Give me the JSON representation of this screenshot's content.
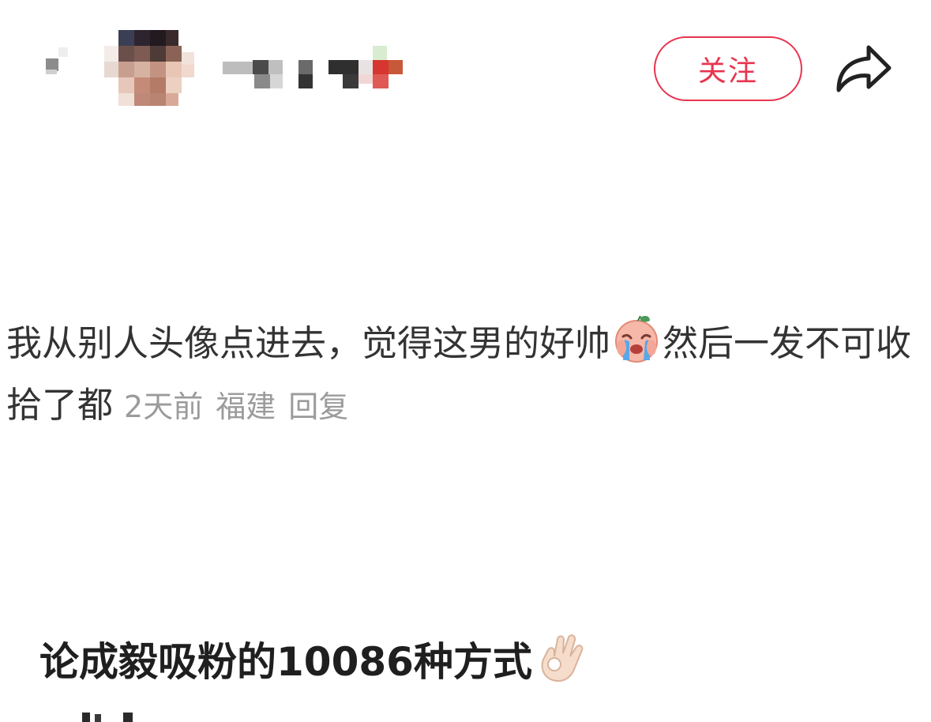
{
  "header": {
    "follow_label": "关注",
    "icons": {
      "back": "back-icon",
      "avatar": "avatar-image",
      "share": "share-arrow-icon"
    },
    "colors": {
      "accent": "#e8344f",
      "text": "#333333",
      "meta": "#9b9b9b"
    }
  },
  "comment": {
    "text_part1": "我从别人头像点进去，觉得这男的好帅",
    "emoji": "crying-face-emoji",
    "text_part2": "然后一发不可收拾了都",
    "time": "2天前",
    "location": "福建",
    "reply_label": "回复"
  },
  "caption": {
    "text": "论成毅吸粉的10086种方式",
    "emoji": "ok-hand-emoji"
  }
}
